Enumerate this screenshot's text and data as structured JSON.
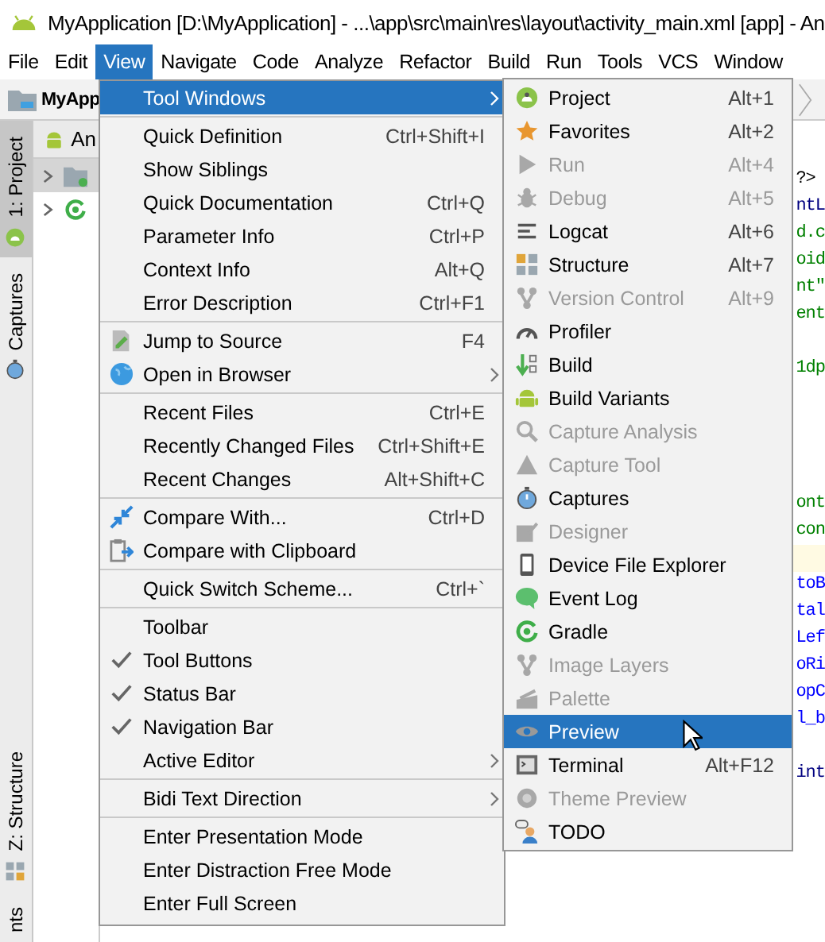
{
  "window": {
    "title": "MyApplication [D:\\MyApplication] - ...\\app\\src\\main\\res\\layout\\activity_main.xml [app] - An"
  },
  "menu_bar": [
    {
      "label": "File",
      "selected": false
    },
    {
      "label": "Edit",
      "selected": false
    },
    {
      "label": "View",
      "selected": true
    },
    {
      "label": "Navigate",
      "selected": false
    },
    {
      "label": "Code",
      "selected": false
    },
    {
      "label": "Analyze",
      "selected": false
    },
    {
      "label": "Refactor",
      "selected": false
    },
    {
      "label": "Build",
      "selected": false
    },
    {
      "label": "Run",
      "selected": false
    },
    {
      "label": "Tools",
      "selected": false
    },
    {
      "label": "VCS",
      "selected": false
    },
    {
      "label": "Window",
      "selected": false
    }
  ],
  "navigation_bar": {
    "crumb": "MyApp"
  },
  "tool_strip": {
    "top": [
      {
        "label": "1: Project",
        "selected": true
      },
      {
        "label": "Captures",
        "selected": false
      }
    ],
    "bottom": [
      {
        "label": "Z: Structure",
        "selected": false
      },
      {
        "label": "nts",
        "selected": false
      }
    ]
  },
  "project_panel": {
    "tab": "An",
    "tree": [
      {
        "selected": true,
        "expanded": false
      },
      {
        "selected": false,
        "expanded": false
      }
    ]
  },
  "editor": {
    "lines": [
      {
        "kind": "code",
        "text": "?>",
        "color": "#000000",
        "current": false
      },
      {
        "kind": "code",
        "text": "ntL",
        "color": "#000080",
        "current": false
      },
      {
        "kind": "code",
        "text": "d.c",
        "color": "#008000",
        "current": false
      },
      {
        "kind": "code",
        "text": "oid",
        "color": "#008000",
        "current": false
      },
      {
        "kind": "code",
        "text": "nt\"",
        "color": "#008000",
        "current": false
      },
      {
        "kind": "code",
        "text": "ent",
        "color": "#008000",
        "current": false
      },
      {
        "kind": "blank",
        "current": false
      },
      {
        "kind": "code",
        "text": "1dp",
        "color": "#008000",
        "current": false
      },
      {
        "kind": "blank",
        "current": false
      },
      {
        "kind": "blank",
        "current": false
      },
      {
        "kind": "blank",
        "current": false
      },
      {
        "kind": "blank",
        "current": false
      },
      {
        "kind": "code",
        "text": "ont",
        "color": "#008000",
        "current": false
      },
      {
        "kind": "code",
        "text": "con",
        "color": "#008000",
        "current": false
      },
      {
        "kind": "blank",
        "current": true
      },
      {
        "kind": "code",
        "text": "toB",
        "color": "#0000ff",
        "current": false
      },
      {
        "kind": "code",
        "text": "tal",
        "color": "#0000ff",
        "current": false
      },
      {
        "kind": "code",
        "text": "Lef",
        "color": "#0000ff",
        "current": false
      },
      {
        "kind": "code",
        "text": "oRi",
        "color": "#0000ff",
        "current": false
      },
      {
        "kind": "code",
        "text": "opC",
        "color": "#0000ff",
        "current": false
      },
      {
        "kind": "code",
        "text": "l_b",
        "color": "#0000ff",
        "current": false
      },
      {
        "kind": "blank",
        "current": false
      },
      {
        "kind": "code",
        "text": "int",
        "color": "#000080",
        "current": false
      }
    ]
  },
  "view_menu": {
    "items": [
      {
        "kind": "item",
        "label": "Tool Windows",
        "checked": false,
        "submenu": true,
        "selected": true
      },
      {
        "kind": "separator"
      },
      {
        "kind": "item",
        "label": "Quick Definition",
        "shortcut": "Ctrl+Shift+I",
        "checked": false,
        "submenu": false,
        "selected": false
      },
      {
        "kind": "item",
        "label": "Show Siblings",
        "checked": false,
        "submenu": false,
        "selected": false
      },
      {
        "kind": "item",
        "label": "Quick Documentation",
        "shortcut": "Ctrl+Q",
        "checked": false,
        "submenu": false,
        "selected": false
      },
      {
        "kind": "item",
        "label": "Parameter Info",
        "shortcut": "Ctrl+P",
        "checked": false,
        "submenu": false,
        "selected": false
      },
      {
        "kind": "item",
        "label": "Context Info",
        "shortcut": "Alt+Q",
        "checked": false,
        "submenu": false,
        "selected": false
      },
      {
        "kind": "item",
        "label": "Error Description",
        "shortcut": "Ctrl+F1",
        "checked": false,
        "submenu": false,
        "selected": false
      },
      {
        "kind": "separator"
      },
      {
        "kind": "item",
        "label": "Jump to Source",
        "shortcut": "F4",
        "checked": false,
        "submenu": false,
        "selected": false
      },
      {
        "kind": "item",
        "label": "Open in Browser",
        "checked": false,
        "submenu": true,
        "selected": false
      },
      {
        "kind": "separator"
      },
      {
        "kind": "item",
        "label": "Recent Files",
        "shortcut": "Ctrl+E",
        "checked": false,
        "submenu": false,
        "selected": false
      },
      {
        "kind": "item",
        "label": "Recently Changed Files",
        "shortcut": "Ctrl+Shift+E",
        "checked": false,
        "submenu": false,
        "selected": false
      },
      {
        "kind": "item",
        "label": "Recent Changes",
        "shortcut": "Alt+Shift+C",
        "checked": false,
        "submenu": false,
        "selected": false
      },
      {
        "kind": "separator"
      },
      {
        "kind": "item",
        "label": "Compare With...",
        "shortcut": "Ctrl+D",
        "checked": false,
        "submenu": false,
        "selected": false
      },
      {
        "kind": "item",
        "label": "Compare with Clipboard",
        "checked": false,
        "submenu": false,
        "selected": false
      },
      {
        "kind": "separator"
      },
      {
        "kind": "item",
        "label": "Quick Switch Scheme...",
        "shortcut": "Ctrl+`",
        "checked": false,
        "submenu": false,
        "selected": false
      },
      {
        "kind": "separator"
      },
      {
        "kind": "item",
        "label": "Toolbar",
        "checked": false,
        "submenu": false,
        "selected": false
      },
      {
        "kind": "item",
        "label": "Tool Buttons",
        "checked": true,
        "submenu": false,
        "selected": false
      },
      {
        "kind": "item",
        "label": "Status Bar",
        "checked": true,
        "submenu": false,
        "selected": false
      },
      {
        "kind": "item",
        "label": "Navigation Bar",
        "checked": true,
        "submenu": false,
        "selected": false
      },
      {
        "kind": "item",
        "label": "Active Editor",
        "checked": false,
        "submenu": true,
        "selected": false
      },
      {
        "kind": "separator"
      },
      {
        "kind": "item",
        "label": "Bidi Text Direction",
        "checked": false,
        "submenu": true,
        "selected": false
      },
      {
        "kind": "separator"
      },
      {
        "kind": "item",
        "label": "Enter Presentation Mode",
        "checked": false,
        "submenu": false,
        "selected": false
      },
      {
        "kind": "item",
        "label": "Enter Distraction Free Mode",
        "checked": false,
        "submenu": false,
        "selected": false
      },
      {
        "kind": "item",
        "label": "Enter Full Screen",
        "checked": false,
        "submenu": false,
        "selected": false
      }
    ]
  },
  "tool_windows_menu": {
    "items": [
      {
        "label": "Project",
        "shortcut": "Alt+1",
        "disabled": false,
        "selected": false
      },
      {
        "label": "Favorites",
        "shortcut": "Alt+2",
        "disabled": false,
        "selected": false
      },
      {
        "label": "Run",
        "shortcut": "Alt+4",
        "disabled": true,
        "selected": false
      },
      {
        "label": "Debug",
        "shortcut": "Alt+5",
        "disabled": true,
        "selected": false
      },
      {
        "label": "Logcat",
        "shortcut": "Alt+6",
        "disabled": false,
        "selected": false
      },
      {
        "label": "Structure",
        "shortcut": "Alt+7",
        "disabled": false,
        "selected": false
      },
      {
        "label": "Version Control",
        "shortcut": "Alt+9",
        "disabled": true,
        "selected": false
      },
      {
        "label": "Profiler",
        "disabled": false,
        "selected": false
      },
      {
        "label": "Build",
        "disabled": false,
        "selected": false
      },
      {
        "label": "Build Variants",
        "disabled": false,
        "selected": false
      },
      {
        "label": "Capture Analysis",
        "disabled": true,
        "selected": false
      },
      {
        "label": "Capture Tool",
        "disabled": true,
        "selected": false
      },
      {
        "label": "Captures",
        "disabled": false,
        "selected": false
      },
      {
        "label": "Designer",
        "disabled": true,
        "selected": false
      },
      {
        "label": "Device File Explorer",
        "disabled": false,
        "selected": false
      },
      {
        "label": "Event Log",
        "disabled": false,
        "selected": false
      },
      {
        "label": "Gradle",
        "disabled": false,
        "selected": false
      },
      {
        "label": "Image Layers",
        "disabled": true,
        "selected": false
      },
      {
        "label": "Palette",
        "disabled": true,
        "selected": false
      },
      {
        "label": "Preview",
        "disabled": false,
        "selected": true
      },
      {
        "label": "Terminal",
        "shortcut": "Alt+F12",
        "disabled": false,
        "selected": false
      },
      {
        "label": "Theme Preview",
        "disabled": true,
        "selected": false
      },
      {
        "label": "TODO",
        "disabled": false,
        "selected": false
      }
    ]
  }
}
